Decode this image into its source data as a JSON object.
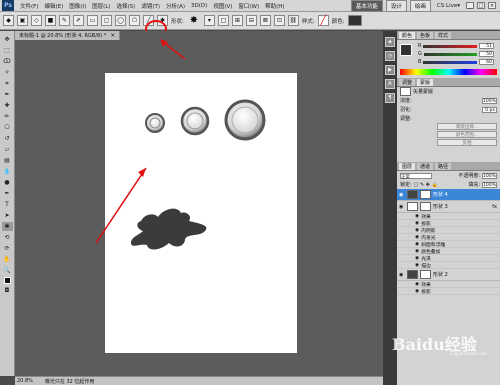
{
  "menubar": {
    "logo": "Ps",
    "items": [
      "文件(F)",
      "编辑(E)",
      "图像(I)",
      "图层(L)",
      "选择(S)",
      "滤镜(T)",
      "分析(A)",
      "3D(D)",
      "视图(V)",
      "窗口(W)",
      "帮助(H)"
    ],
    "workspaces": [
      "基本功能",
      "设计",
      "绘画"
    ],
    "cs_live": "CS Live▾",
    "window_controls": [
      "_",
      "□",
      "×"
    ]
  },
  "options_bar": {
    "shape_label": "形状:",
    "style_label": "样式:",
    "color_label": "颜色:"
  },
  "document": {
    "tab_title": "未标题-1 @ 20.8% (形状 4, RGB/8) *",
    "zoom": "20.8%",
    "status": "曝光只在 32 位起作用"
  },
  "color_panel": {
    "tabs": [
      "颜色",
      "色板",
      "样式"
    ],
    "rows": [
      {
        "channel": "R",
        "value": "51",
        "color": "#e02020"
      },
      {
        "channel": "G",
        "value": "50",
        "color": "#20a020"
      },
      {
        "channel": "B",
        "value": "60",
        "color": "#2040e0"
      }
    ]
  },
  "adjust_panel": {
    "tabs": [
      "调整",
      "蒙版"
    ],
    "title": "矢量蒙版",
    "density_label": "浓度:",
    "density_value": "100%",
    "feather_label": "羽化:",
    "feather_value": "0 px",
    "refine_label": "调整:",
    "buttons": [
      "蒙版边缘...",
      "颜色范围...",
      "反相"
    ]
  },
  "layers_panel": {
    "tabs": [
      "图层",
      "通道",
      "路径"
    ],
    "blend_mode": "正常",
    "opacity_label": "不透明度:",
    "opacity": "100%",
    "lock_label": "锁定:",
    "fill_label": "填充:",
    "fill": "100%",
    "layers": [
      {
        "name": "形状 4",
        "selected": true,
        "dark": true
      },
      {
        "name": "形状 3",
        "selected": false,
        "dark": false
      }
    ],
    "effects_label": "效果",
    "effects": [
      "投影",
      "内阴影",
      "内发光",
      "斜面和浮雕",
      "颜色叠加",
      "光泽",
      "描边"
    ],
    "layer3": {
      "name": "形状 2",
      "dark": true
    },
    "effects2": [
      "效果",
      "投影"
    ]
  },
  "watermark": {
    "text": "Baidu经验",
    "sub": "jingyan.baidu.com"
  },
  "colors": {
    "accent_red": "#e01010",
    "selection_blue": "#3b86d6",
    "shape_fill": "#3b3b3b"
  }
}
